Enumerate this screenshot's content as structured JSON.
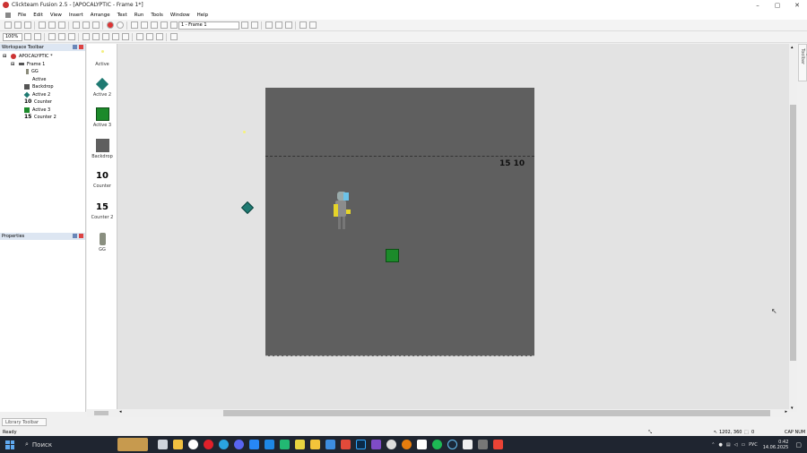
{
  "window": {
    "title": "Clickteam Fusion 2.5 - [APOCALYPTIC - Frame 1*]",
    "controls": [
      "–",
      "▢",
      "✕"
    ]
  },
  "menu": [
    "File",
    "Edit",
    "View",
    "Insert",
    "Arrange",
    "Text",
    "Run",
    "Tools",
    "Window",
    "Help"
  ],
  "toolbar2": {
    "zoom": "100%",
    "frame_select": "1 - Frame 1"
  },
  "workspace": {
    "header": "Workspace Toolbar",
    "app_name": "APOCALYPTIC *",
    "frame_name": "Frame 1",
    "objects": [
      {
        "name": "GG",
        "icon": "sprite-icon"
      },
      {
        "name": "Active",
        "icon": "active-icon"
      },
      {
        "name": "Backdrop",
        "icon": "backdrop-icon"
      },
      {
        "name": "Active 2",
        "icon": "diamond-icon"
      },
      {
        "name": "Counter",
        "icon": "counter-icon",
        "glyph": "10"
      },
      {
        "name": "Active 3",
        "icon": "green-square-icon"
      },
      {
        "name": "Counter 2",
        "icon": "counter-icon",
        "glyph": "15"
      }
    ]
  },
  "properties": {
    "header": "Properties"
  },
  "shelf": [
    {
      "label": "Active"
    },
    {
      "label": "Active 2"
    },
    {
      "label": "Active 3"
    },
    {
      "label": "Backdrop"
    },
    {
      "label": "Counter",
      "glyph": "10"
    },
    {
      "label": "Counter 2",
      "glyph": "15"
    },
    {
      "label": "GG"
    }
  ],
  "frame": {
    "counter_text": "15 10"
  },
  "layers_tab": "Layers Toolbar",
  "library_tab": "Library Toolbar",
  "status": {
    "left": "Ready",
    "coords": "1202, 360",
    "count": "0",
    "keys": "CAP NUM"
  },
  "taskbar": {
    "search_placeholder": "Поиск",
    "lang": "РУС",
    "time": "0:42",
    "date": "14.06.2025"
  },
  "colors": {
    "frame": "#5f5f5f",
    "editor_bg": "#e3e3e3",
    "taskbar": "#1f2530"
  }
}
